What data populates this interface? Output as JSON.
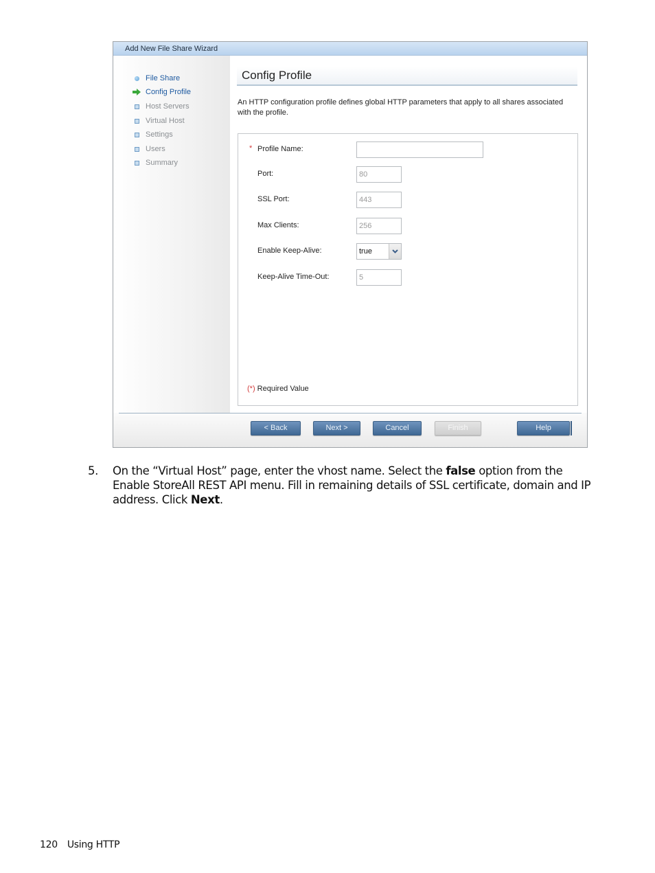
{
  "wizard": {
    "title": "Add New File Share Wizard",
    "nav": [
      {
        "label": "File Share",
        "state": "done",
        "icon": "dot-icon"
      },
      {
        "label": "Config Profile",
        "state": "active",
        "icon": "arrow-right-icon"
      },
      {
        "label": "Host Servers",
        "state": "pending",
        "icon": "square-icon"
      },
      {
        "label": "Virtual Host",
        "state": "pending",
        "icon": "square-icon"
      },
      {
        "label": "Settings",
        "state": "pending",
        "icon": "square-icon"
      },
      {
        "label": "Users",
        "state": "pending",
        "icon": "square-icon"
      },
      {
        "label": "Summary",
        "state": "pending",
        "icon": "square-icon"
      }
    ],
    "heading": "Config Profile",
    "description": "An HTTP configuration profile defines global HTTP parameters that apply to all shares associated with the profile.",
    "form": {
      "required_marker": "*",
      "profile_name": {
        "label": "Profile Name:",
        "value": ""
      },
      "port": {
        "label": "Port:",
        "value": "80"
      },
      "ssl_port": {
        "label": "SSL Port:",
        "value": "443"
      },
      "max_clients": {
        "label": "Max Clients:",
        "value": "256"
      },
      "keep_alive": {
        "label": "Enable Keep-Alive:",
        "value": "true"
      },
      "keep_alive_timeout": {
        "label": "Keep-Alive Time-Out:",
        "value": "5"
      },
      "required_note_star": "(*)",
      "required_note_text": " Required Value"
    },
    "buttons": {
      "back": "< Back",
      "next": "Next >",
      "cancel": "Cancel",
      "finish": "Finish",
      "help": "Help"
    },
    "colors": {
      "accent": "#1e5aa0",
      "button": "#4f78a5",
      "required": "#d23b3b",
      "arrow": "#3aa83a"
    }
  },
  "step": {
    "number": "5.",
    "text_1": "On the “Virtual Host” page, enter the vhost name. Select the ",
    "bold_1": "false",
    "text_2": " option from the Enable StoreAll REST API menu. Fill in remaining details of SSL certificate, domain and IP address. Click ",
    "bold_2": "Next",
    "text_3": "."
  },
  "footer": {
    "page_number": "120",
    "section": "Using HTTP"
  }
}
